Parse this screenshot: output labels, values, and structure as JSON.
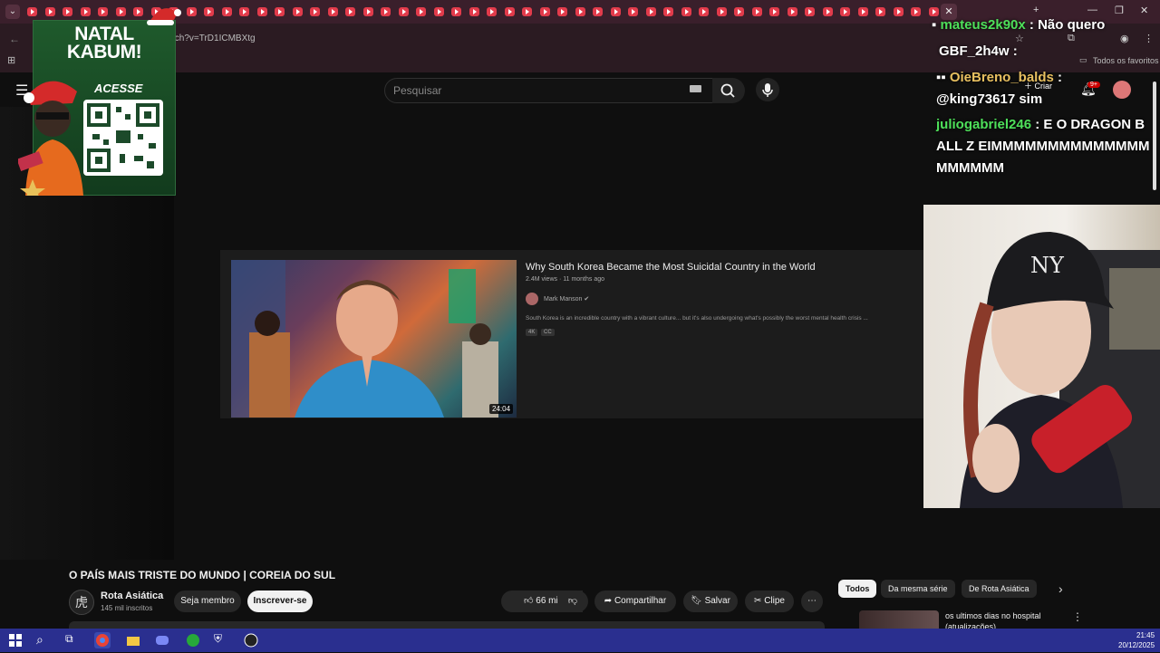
{
  "browser": {
    "tab_count_visible": 52,
    "url_fragment": "tch?v=TrD1ICMBXtg",
    "bookmarks_label": "Todos os favoritos",
    "accent": "#e23b4b"
  },
  "youtube": {
    "search_placeholder": "Pesquisar",
    "create_label": "Criar",
    "notifications_badge": "9+",
    "video": {
      "title": "O PAÍS MAIS TRISTE DO MUNDO | COREIA DO SUL",
      "channel": "Rota Asiática",
      "subscribers": "145 mil inscritos",
      "member_label": "Seja membro",
      "subscribe_label": "Inscrever-se",
      "likes": "66 mil",
      "share_label": "Compartilhar",
      "save_label": "Salvar",
      "clip_label": "Clipe"
    },
    "embedded_result": {
      "title": "Why South Korea Became the Most Suicidal Country in the World",
      "meta": "2.4M views · 11 months ago",
      "channel": "Mark Manson",
      "description": "South Korea is an incredible country with a vibrant culture... but it's also undergoing what's possibly the worst mental health crisis ...",
      "badges": [
        "4K",
        "CC"
      ],
      "duration": "24:04"
    },
    "chips": [
      "Todos",
      "Da mesma série",
      "De Rota Asiática"
    ],
    "recommendation_title": "os ultimos dias no hospital (atualizações)"
  },
  "sponsor": {
    "title_line1": "NATAL",
    "title_line2": "KABUM!",
    "cta": "ACESSE"
  },
  "chat": [
    {
      "user": "mateus2k90x",
      "message": "Não quero"
    },
    {
      "user": "GBF_2h4w",
      "message": ""
    },
    {
      "user": "OieBreno_balds",
      "message": "@king73617 sim"
    },
    {
      "user": "juliogabriel246",
      "message": "E O DRAGON BALL Z EIMMMMMMMMMMMMMMMMMMMM"
    }
  ],
  "taskbar": {
    "time": "21:45",
    "date": "20/12/2025"
  }
}
